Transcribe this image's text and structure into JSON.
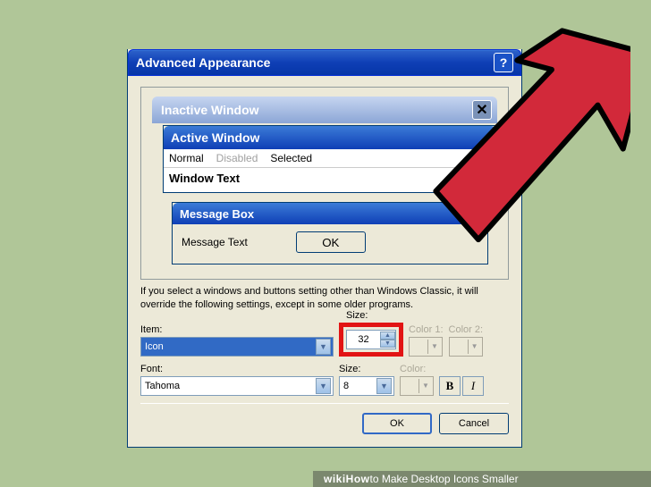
{
  "dialog": {
    "title": "Advanced Appearance",
    "help": "?",
    "description": "If you select a windows and buttons setting other than Windows Classic, it will override the following settings, except in some older programs."
  },
  "preview": {
    "inactive_title": "Inactive Window",
    "active_title": "Active Window",
    "menu": {
      "normal": "Normal",
      "disabled": "Disabled",
      "selected": "Selected"
    },
    "window_text": "Window Text",
    "msgbox_title": "Message Box",
    "msgbox_text": "Message Text",
    "msgbox_ok": "OK"
  },
  "labels": {
    "item": "Item:",
    "size": "Size:",
    "color1": "Color 1:",
    "color2": "Color 2:",
    "font": "Font:",
    "color": "Color:"
  },
  "values": {
    "item": "Icon",
    "item_size": "32",
    "font": "Tahoma",
    "font_size": "8",
    "bold": "B",
    "italic": "I"
  },
  "buttons": {
    "ok": "OK",
    "cancel": "Cancel"
  },
  "caption": {
    "brand": "wikiHow",
    "text": " to Make Desktop Icons Smaller"
  }
}
